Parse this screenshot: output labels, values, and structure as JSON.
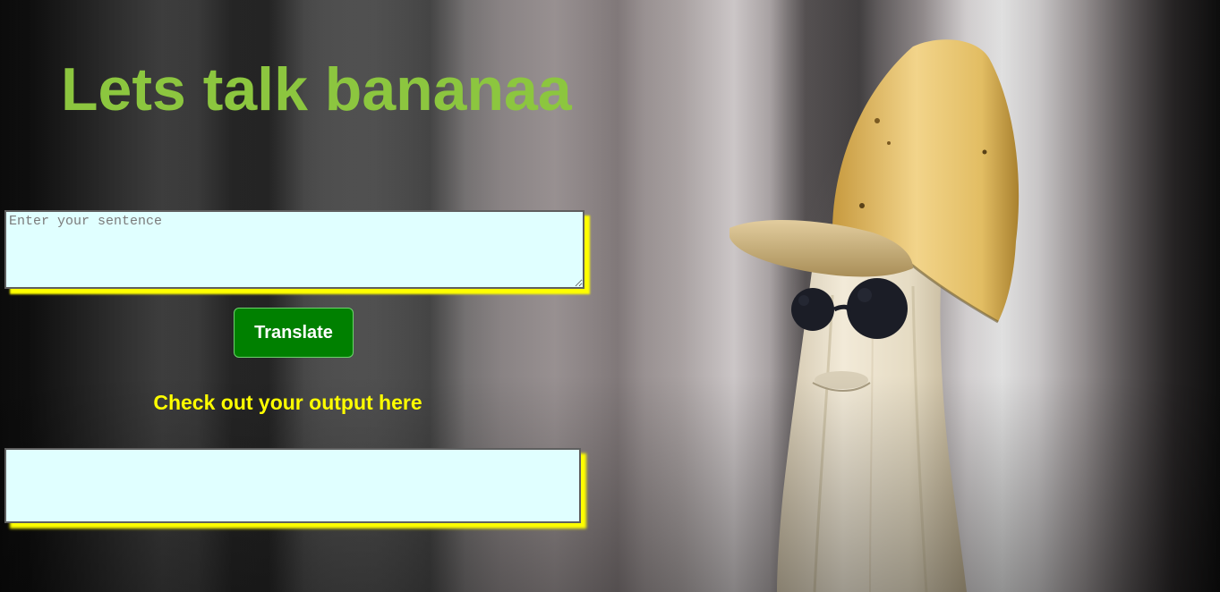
{
  "header": {
    "title": "Lets talk bananaa"
  },
  "input": {
    "placeholder": "Enter your sentence",
    "value": ""
  },
  "actions": {
    "translate_label": "Translate"
  },
  "output": {
    "heading": "Check out your output here",
    "text": ""
  },
  "theme": {
    "title_color": "#8cc63f",
    "heading_color": "#ffff00",
    "button_color": "#008000",
    "field_background": "#e0ffff",
    "shadow_color": "#ffff00"
  },
  "background": {
    "subject": "banana-with-cap-and-sunglasses"
  }
}
